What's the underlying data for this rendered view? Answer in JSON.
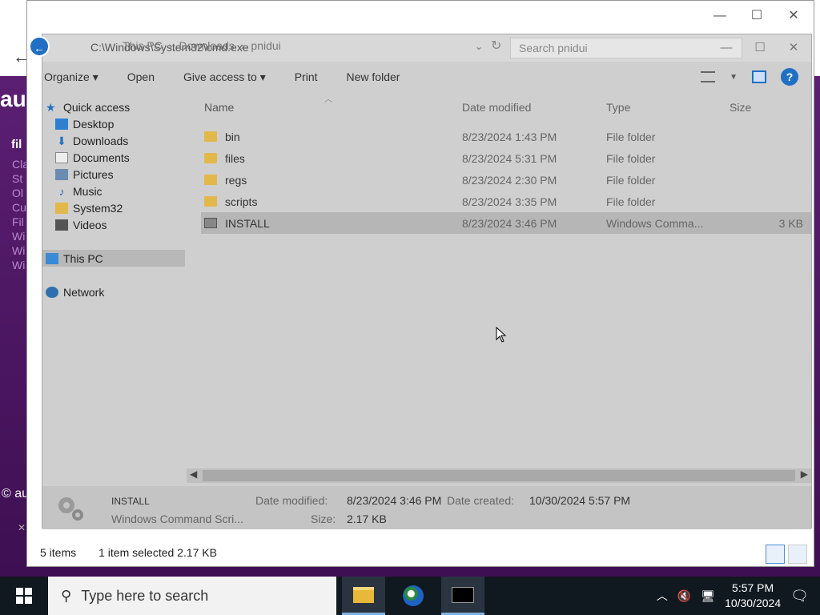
{
  "background_page": {
    "title_fragment": "au",
    "subtitle_fragment": "fil",
    "links": [
      "Cla",
      "St",
      "Ol",
      "Cu",
      "Fil",
      "Wi",
      "Wi",
      "Wi"
    ],
    "copyright_fragment": "© au"
  },
  "window": {
    "minimize_glyph": "—",
    "maximize_glyph": "☐",
    "close_glyph": "✕"
  },
  "explorer": {
    "cmd_ghost_title": "C:\\Windows\\System32\\cmd.exe",
    "breadcrumb": [
      "This PC",
      "Downloads",
      "pnidui"
    ],
    "search_placeholder": "Search pnidui",
    "toolbar": {
      "organize": "Organize ▾",
      "open": "Open",
      "give_access": "Give access to ▾",
      "print": "Print",
      "new_folder": "New folder"
    },
    "nav": {
      "quick_access": "Quick access",
      "items": [
        "Desktop",
        "Downloads",
        "Documents",
        "Pictures",
        "Music",
        "System32",
        "Videos"
      ],
      "this_pc": "This PC",
      "network": "Network"
    },
    "columns": {
      "name": "Name",
      "date": "Date modified",
      "type": "Type",
      "size": "Size"
    },
    "files": [
      {
        "name": "bin",
        "date": "8/23/2024 1:43 PM",
        "type": "File folder",
        "size": "",
        "kind": "folder"
      },
      {
        "name": "files",
        "date": "8/23/2024 5:31 PM",
        "type": "File folder",
        "size": "",
        "kind": "folder"
      },
      {
        "name": "regs",
        "date": "8/23/2024 2:30 PM",
        "type": "File folder",
        "size": "",
        "kind": "folder"
      },
      {
        "name": "scripts",
        "date": "8/23/2024 3:35 PM",
        "type": "File folder",
        "size": "",
        "kind": "folder"
      },
      {
        "name": "INSTALL",
        "date": "8/23/2024 3:46 PM",
        "type": "Windows Comma...",
        "size": "3 KB",
        "kind": "cmd"
      }
    ],
    "details": {
      "name": "INSTALL",
      "type": "Windows Command Scri...",
      "date_modified_label": "Date modified:",
      "date_modified": "8/23/2024 3:46 PM",
      "date_created_label": "Date created:",
      "date_created": "10/30/2024 5:57 PM",
      "size_label": "Size:",
      "size": "2.17 KB"
    },
    "status": {
      "count": "5 items",
      "selection": "1 item selected  2.17 KB"
    }
  },
  "taskbar": {
    "search_placeholder": "Type here to search",
    "time": "5:57 PM",
    "date": "10/30/2024"
  },
  "colors": {
    "accent": "#1f6fc4",
    "background_purple": "#5b1f72",
    "taskbar": "#101820"
  }
}
